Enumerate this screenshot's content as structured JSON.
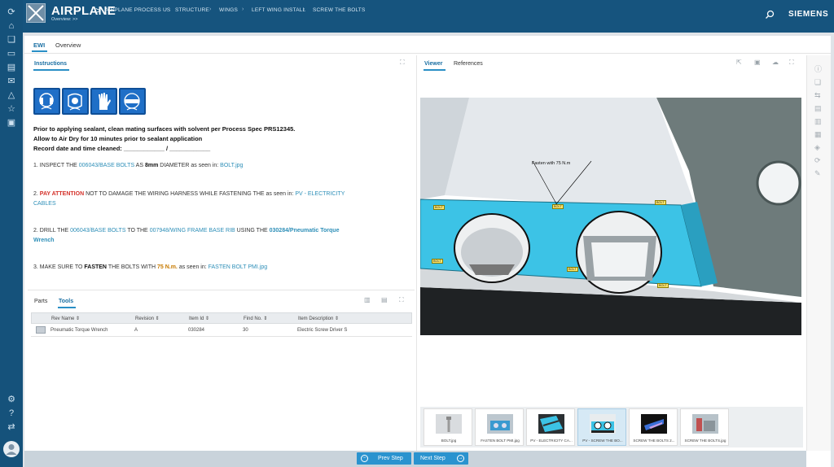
{
  "header": {
    "app_title": "AIRPLANE",
    "title_sep": ">",
    "breadcrumb": [
      "AIRPLANE PROCESS US",
      "STRUCTURE",
      "WINGS",
      "LEFT WING INSTALL",
      "SCREW THE BOLTS"
    ],
    "subline": "Overview:  >>",
    "brand": "SIEMENS",
    "search_icon": "search-icon"
  },
  "tabs": {
    "ewi": "EWI",
    "overview": "Overview"
  },
  "instructions": {
    "tab_label": "Instructions",
    "ppe_icons": [
      "ear-protection-icon",
      "face-shield-icon",
      "gloves-icon",
      "safety-goggles-icon"
    ],
    "prep": [
      "Prior to applying sealant, clean mating surfaces with solvent per Process Spec PRS12345.",
      "Allow to Air Dry for 10 minutes prior to sealant application",
      "Record date and time cleaned: ____________ / ____________"
    ],
    "step1": {
      "pre": "1. INSPECT THE ",
      "link": "006043/BASE BOLTS",
      "mid": "  AS ",
      "size": "8mm",
      "post": " DIAMETER as seen in: ",
      "file": "BOLT.jpg"
    },
    "step2": {
      "pre": "2. ",
      "warn": "PAY ATTENTION",
      "mid": " NOT TO DAMAGE THE WIRING HARNESS WHILE FASTENING THE as seen in: ",
      "link": "PV - ELECTRICITY",
      "link2": "CABLES"
    },
    "step3": {
      "pre": "2. DRILL THE ",
      "link": "006043/BASE BOLTS",
      "mid": " TO THE ",
      "link2": "007948/WING FRAME BASE RIB",
      "mid2": " USING THE ",
      "tool": "030284/Pneumatic Torque",
      "tool2": "Wrench"
    },
    "step4": {
      "pre": "3. MAKE SURE TO ",
      "fasten": "FASTEN",
      "mid": " THE BOLTS WITH ",
      "torque": "75 N.m.",
      "post": " as seen in: ",
      "file": "FASTEN BOLT PMI.jpg"
    }
  },
  "tools": {
    "tabs": {
      "parts": "Parts",
      "tools": "Tools"
    },
    "columns": [
      "Rev Name",
      "Revision",
      "Item Id",
      "Find No.",
      "Item Description"
    ],
    "rows": [
      {
        "name": "Pneumatic Torque Wrench",
        "revision": "A",
        "item_id": "030284",
        "find_no": "30",
        "description": "Electric Screw Driver S"
      }
    ]
  },
  "viewer": {
    "tabs": {
      "viewer": "Viewer",
      "references": "References"
    },
    "annotation": "Fasten with 75 N.m",
    "bolt_label": "BOLT",
    "thumbnails": [
      "BOLT.jpg",
      "FASTEN BOLT PMI.jpg",
      "PV - ELECTRICITY CA...",
      "PV - SCREW THE BO...",
      "SCREW THE BOLTS 2...",
      "SCREW THE BOLTS.jpg"
    ],
    "selected_thumbnail": 3
  },
  "nav": {
    "prev": "Prev Step",
    "next": "Next Step"
  },
  "colors": {
    "header": "#16547e",
    "accent": "#2a93cf",
    "part_cyan": "#3cc3e6"
  }
}
